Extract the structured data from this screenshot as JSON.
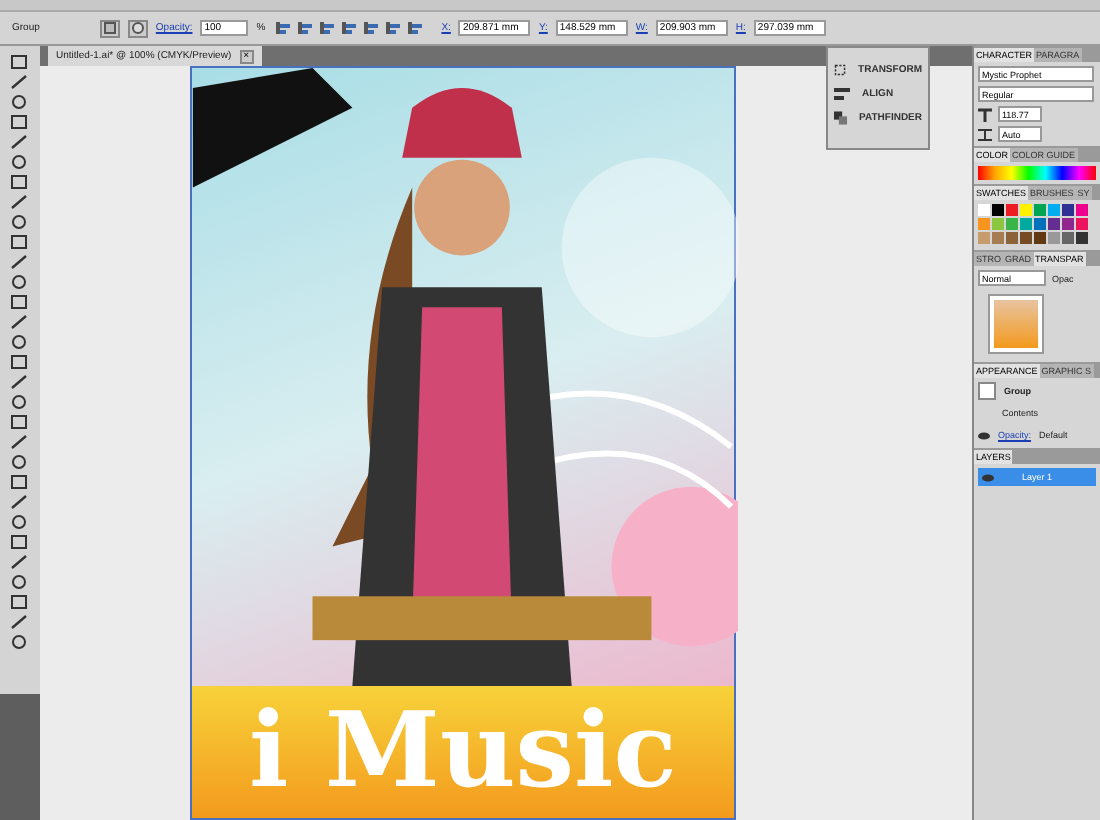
{
  "control_bar": {
    "selection": "Group",
    "opacity_label": "Opacity:",
    "opacity": "100",
    "percent": "%",
    "fields": [
      {
        "label": "X:",
        "value": "209.871 mm"
      },
      {
        "label": "Y:",
        "value": "148.529 mm"
      },
      {
        "label": "W:",
        "value": "209.903 mm"
      },
      {
        "label": "H:",
        "value": "297.039 mm"
      }
    ]
  },
  "document_tab": {
    "title": "Untitled-1.ai* @ 100% (CMYK/Preview)",
    "close": "×"
  },
  "artwork": {
    "title": "i Music"
  },
  "floating_panel": {
    "items": [
      "TRANSFORM",
      "ALIGN",
      "PATHFINDER"
    ]
  },
  "character_panel": {
    "tabs": [
      {
        "label": "CHARACTER",
        "selected": true
      },
      {
        "label": "PARAGRA",
        "selected": false
      }
    ],
    "font_family": "Mystic Prophet",
    "font_style": "Regular",
    "font_size": "118.77",
    "leading": "Auto"
  },
  "color_panel": {
    "tabs": [
      {
        "label": "COLOR",
        "selected": true
      },
      {
        "label": "COLOR GUIDE",
        "selected": false
      }
    ]
  },
  "swatches_panel": {
    "tabs": [
      {
        "label": "SWATCHES",
        "selected": true
      },
      {
        "label": "BRUSHES",
        "selected": false
      },
      {
        "label": "SY",
        "selected": false
      }
    ]
  },
  "transparency_panel": {
    "tabs": [
      {
        "label": "STRO",
        "selected": false
      },
      {
        "label": "GRAD",
        "selected": false
      },
      {
        "label": "TRANSPAR",
        "selected": true
      }
    ],
    "blend_mode": "Normal",
    "opacity_label": "Opac"
  },
  "appearance_panel": {
    "tabs": [
      {
        "label": "APPEARANCE",
        "selected": true
      },
      {
        "label": "GRAPHIC S",
        "selected": false
      }
    ],
    "rows": [
      {
        "kind": "header",
        "label": "Group"
      },
      {
        "kind": "item",
        "label": "Contents"
      },
      {
        "kind": "property",
        "label": "Opacity:",
        "value": "Default"
      }
    ]
  },
  "layers_panel": {
    "tabs": [
      {
        "label": "LAYERS",
        "selected": true
      }
    ],
    "layers": [
      {
        "name": "Layer 1",
        "selected": true
      }
    ]
  }
}
